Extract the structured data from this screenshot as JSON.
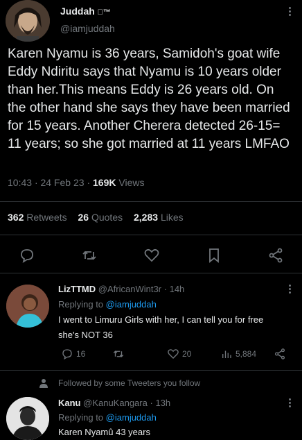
{
  "main": {
    "author_name": "Juddah",
    "author_badge": "™",
    "author_handle": "@iamjuddah",
    "text": "Karen Nyamu is 36 years, Samidoh's goat wife Eddy Ndiritu says that Nyamu is 10 years older than her.This means Eddy is 26 years old. On the other hand she says they have been married for 15 years. Another Cherera detected 26-15= 11 years; so she got married at 11 years LMFAO",
    "time": "10:43",
    "date": "24 Feb 23",
    "views": "169K",
    "views_label": "Views",
    "retweets": "362",
    "retweets_label": "Retweets",
    "quotes": "26",
    "quotes_label": "Quotes",
    "likes": "2,283",
    "likes_label": "Likes"
  },
  "replies": [
    {
      "name": "LizTTMD",
      "handle": "@AfricanWint3r",
      "time": "14h",
      "replying_prefix": "Replying to",
      "replying_to": "@iamjuddah",
      "text_line1": "I went to Limuru Girls with her, I can tell you for free",
      "text_line2": "she's NOT 36",
      "replies_count": "16",
      "likes_count": "20",
      "views_count": "5,884"
    },
    {
      "name": "Kanu",
      "handle": "@KanuKangara",
      "time": "13h",
      "replying_prefix": "Replying to",
      "replying_to": "@iamjuddah",
      "text_line1": "Karen Nyamû 43 years"
    }
  ],
  "followed_note": "Followed by some Tweeters you follow",
  "colors": {
    "background": "#000000",
    "text": "#e7e9ea",
    "muted": "#71767b",
    "link": "#1d9bf0",
    "divider": "#2f3336"
  }
}
